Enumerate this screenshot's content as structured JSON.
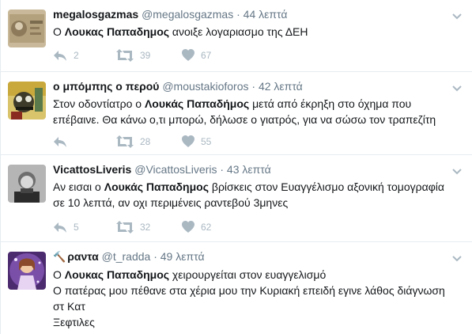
{
  "tweets": [
    {
      "fullname": "megalosgazmas",
      "username": "@megalosgazmas",
      "time": "44 λεπτά",
      "text_before": "Ο ",
      "text_bold": "Λουκας Παπαδημος",
      "text_after": " ανοιξε λογαριασμο της ΔΕΗ",
      "replies": "2",
      "retweets": "39",
      "likes": "67"
    },
    {
      "fullname": "ο μπόμπης ο περού",
      "username": "@moustakioforos",
      "time": "42 λεπτά",
      "text_before": "Στον οδοντίατρο ο ",
      "text_bold": "Λουκάς Παπαδήμος",
      "text_after": " μετά από έκρηξη στο όχημα που επέβαινε. Θα κάνω ο,τι μπορώ, δήλωσε ο γιατρός, για να σώσω τον τραπεζίτη",
      "replies": "",
      "retweets": "28",
      "likes": "55"
    },
    {
      "fullname": "VicattosLiveris",
      "username": "@VicattosLiveris",
      "time": "43 λεπτά",
      "text_before": "Αν εισαι ο ",
      "text_bold": "Λουκάς Παπαδημος",
      "text_after": " βρίσκεις στον Ευαγγέλισμο αξονική τομογραφία σε 10 λεπτά, αν οχι περιμένεις ραντεβού 3μηνες",
      "replies": "5",
      "retweets": "32",
      "likes": "62"
    },
    {
      "fullname_icon": "🔨",
      "fullname": "ραντα",
      "username": "@t_radda",
      "time": "49 λεπτά",
      "text_before": "Ο ",
      "text_bold": "Λουκας Παπαδημος",
      "text_after": " χειρουργείται στον ευαγγελισμό",
      "text_line2": "Ο πατέρας μου πέθανε στα χέρια μου την Κυριακή επειδή εγινε λάθος διάγνωση στ Κατ",
      "text_line3": "Ξεφτιλες"
    }
  ],
  "separator": "·",
  "colors": {
    "action_gray": "#aab8c2",
    "meta_gray": "#657786",
    "border": "#e6ecf0"
  },
  "icons": {
    "reply": "reply-icon",
    "retweet": "retweet-icon",
    "like": "heart-icon",
    "menu": "chevron-down-icon"
  }
}
